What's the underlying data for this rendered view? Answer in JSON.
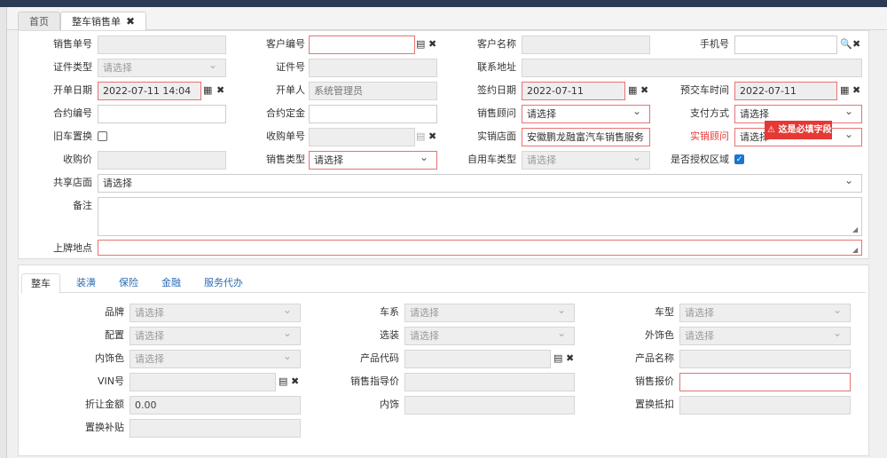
{
  "tabs": [
    {
      "label": "首页"
    },
    {
      "label": "整车销售单",
      "close": "✖"
    }
  ],
  "header": {
    "order_no_label": "销售单号",
    "order_no_value": "",
    "customer_no_label": "客户编号",
    "customer_no_value": "",
    "customer_name_label": "客户名称",
    "customer_name_value": "",
    "phone_label": "手机号",
    "phone_value": "",
    "id_type_label": "证件类型",
    "id_type_value": "请选择",
    "id_no_label": "证件号",
    "id_no_value": "",
    "address_label": "联系地址",
    "address_value": "",
    "open_date_label": "开单日期",
    "open_date_value": "2022-07-11 14:04",
    "opener_label": "开单人",
    "opener_value": "系统管理员",
    "sign_date_label": "签约日期",
    "sign_date_value": "2022-07-11",
    "delivery_label": "预交车时间",
    "delivery_value": "2022-07-11",
    "contract_no_label": "合约编号",
    "contract_no_value": "",
    "deposit_label": "合约定金",
    "deposit_value": "",
    "consultant_label": "销售顾问",
    "consultant_value": "请选择",
    "payment_label": "支付方式",
    "payment_value": "请选择",
    "trade_in_label": "旧车置换",
    "receipt_no_label": "收购单号",
    "receipt_no_value": "",
    "store_label": "实销店面",
    "store_value": "安徽鹏龙融富汽车销售服务",
    "actual_consultant_label": "实销顾问",
    "actual_consultant_value": "请选择",
    "required_tip": "这是必填字段",
    "purchase_price_label": "收购价",
    "purchase_price_value": "",
    "sale_type_label": "销售类型",
    "sale_type_value": "请选择",
    "own_car_type_label": "自用车类型",
    "own_car_type_value": "请选择",
    "authorized_label": "是否授权区域",
    "shared_store_label": "共享店面",
    "shared_store_value": "请选择",
    "remark_label": "备注",
    "remark_value": "",
    "plate_label": "上牌地点",
    "plate_value": ""
  },
  "subtabs": [
    {
      "label": "整车"
    },
    {
      "label": "装潢"
    },
    {
      "label": "保险"
    },
    {
      "label": "金融"
    },
    {
      "label": "服务代办"
    }
  ],
  "vehicle": {
    "brand_label": "品牌",
    "brand_value": "请选择",
    "series_label": "车系",
    "series_value": "请选择",
    "model_label": "车型",
    "model_value": "请选择",
    "config_label": "配置",
    "config_value": "请选择",
    "option_label": "选装",
    "option_value": "请选择",
    "ext_color_label": "外饰色",
    "ext_color_value": "请选择",
    "int_color_label": "内饰色",
    "int_color_value": "请选择",
    "product_code_label": "产品代码",
    "product_code_value": "",
    "product_name_label": "产品名称",
    "product_name_value": "",
    "vin_label": "VIN号",
    "vin_value": "",
    "guide_price_label": "销售指导价",
    "guide_price_value": "",
    "quote_label": "销售报价",
    "quote_value": "",
    "discount_label": "折让金额",
    "discount_value": "0.00",
    "interior_label": "内饰",
    "interior_value": "",
    "trade_offset_label": "置换抵扣",
    "trade_offset_value": "",
    "trade_subsidy_label": "置换补贴",
    "trade_subsidy_value": ""
  }
}
